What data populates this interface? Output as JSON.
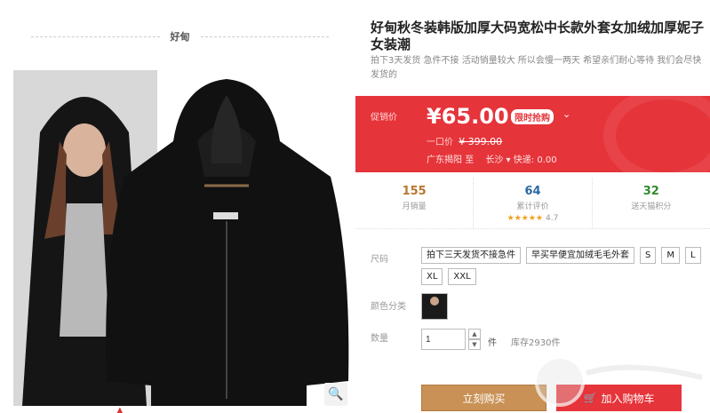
{
  "shop": {
    "name": "好甸"
  },
  "product": {
    "title": "好甸秋冬装韩版加厚大码宽松中长款外套女加绒加厚妮子女装潮",
    "subtitle": "拍下3天发货 急件不接 活动销量较大 所以会慢一两天 希望亲们耐心等待 我们会尽快发货的"
  },
  "promo": {
    "label": "促销价",
    "price": "¥65.00",
    "tag": "限时抢购",
    "orig_label": "一口价",
    "orig_price": "¥ 399.00",
    "ship_from": "广东揭阳",
    "ship_to_label": "至",
    "ship_city": "长沙",
    "express_label": "快递:",
    "express_fee": "0.00",
    "bg_color": "#e5343a"
  },
  "stats": [
    {
      "num": "155",
      "cap": "月销量",
      "color": "#b8752f"
    },
    {
      "num": "64",
      "cap": "累计评价",
      "color": "#2b6aa3"
    },
    {
      "num": "32",
      "cap": "送天猫积分",
      "color": "#2f8a2f"
    }
  ],
  "rating": {
    "stars": "★★★★★",
    "score": "4.7"
  },
  "sku": {
    "size_label": "尺码",
    "sizes": [
      "拍下三天发货不接急件",
      "早买早便宜加绒毛毛外套",
      "S",
      "M",
      "L",
      "XL",
      "XXL"
    ],
    "color_label": "颜色分类",
    "qty_label": "数量",
    "qty_value": "1",
    "unit": "件",
    "stock": "库存2930件"
  },
  "actions": {
    "buy": "立刻购买",
    "cart": "加入购物车"
  },
  "icons": {
    "zoom": "magnifier-icon",
    "cart": "cart-icon",
    "caret": "caret-up-icon"
  }
}
